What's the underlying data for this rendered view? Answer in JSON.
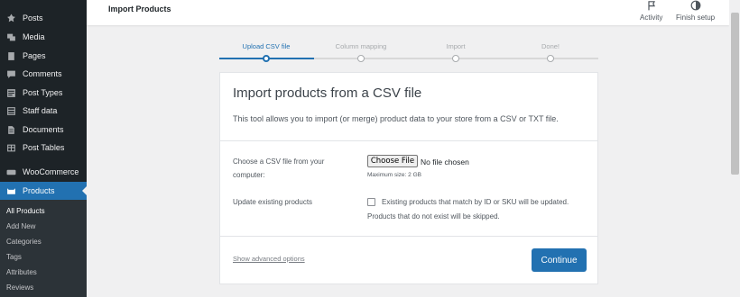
{
  "sidebar": {
    "items": [
      {
        "label": "Posts",
        "icon": "pin-icon"
      },
      {
        "label": "Media",
        "icon": "media-icon"
      },
      {
        "label": "Pages",
        "icon": "pages-icon"
      },
      {
        "label": "Comments",
        "icon": "comments-icon"
      },
      {
        "label": "Post Types",
        "icon": "post-types-icon"
      },
      {
        "label": "Staff data",
        "icon": "staff-data-icon"
      },
      {
        "label": "Documents",
        "icon": "documents-icon"
      },
      {
        "label": "Post Tables",
        "icon": "table-icon"
      },
      {
        "label": "WooCommerce",
        "icon": "woocommerce-icon"
      },
      {
        "label": "Products",
        "icon": "products-icon"
      }
    ],
    "submenu": [
      "All Products",
      "Add New",
      "Categories",
      "Tags",
      "Attributes",
      "Reviews"
    ]
  },
  "header": {
    "title": "Import Products",
    "activity_label": "Activity",
    "finish_setup_label": "Finish setup"
  },
  "stepper": {
    "steps": [
      "Upload CSV file",
      "Column mapping",
      "Import",
      "Done!"
    ],
    "active_index": 0
  },
  "card": {
    "title": "Import products from a CSV file",
    "description": "This tool allows you to import (or merge) product data to your store from a CSV or TXT file.",
    "file_field_label": "Choose a CSV file from your computer:",
    "choose_file_label": "Choose File",
    "file_status": "No file chosen",
    "max_size": "Maximum size: 2 GB",
    "update_label": "Update existing products",
    "update_checkbox_text": "Existing products that match by ID or SKU will be updated. Products that do not exist will be skipped.",
    "update_checked": false,
    "advanced_link": "Show advanced options",
    "continue_label": "Continue"
  },
  "colors": {
    "sidebar_bg": "#1d2327",
    "accent": "#2271b1",
    "page_bg": "#f0f0f1"
  }
}
